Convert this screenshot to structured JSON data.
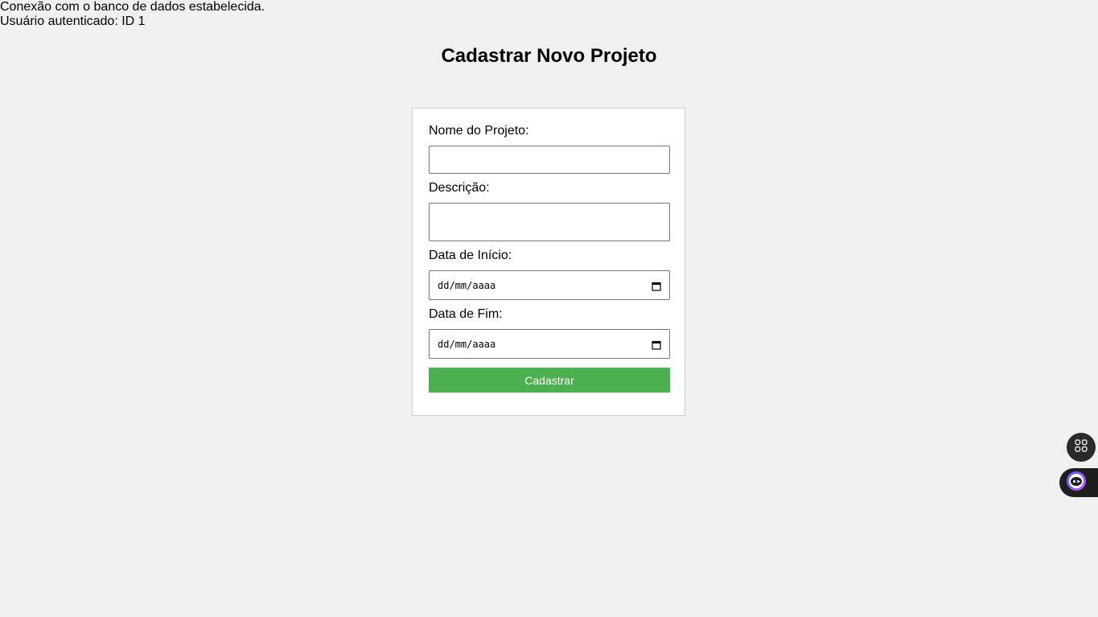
{
  "status": {
    "line1": "Conexão com o banco de dados estabelecida.",
    "line2": "Usuário autenticado: ID 1"
  },
  "page": {
    "title": "Cadastrar Novo Projeto"
  },
  "form": {
    "name_label": "Nome do Projeto:",
    "name_value": "",
    "description_label": "Descrição:",
    "description_value": "",
    "start_label": "Data de Início:",
    "start_placeholder": "dd/mm/aaaa",
    "end_label": "Data de Fim:",
    "end_placeholder": "dd/mm/aaaa",
    "submit_label": "Cadastrar"
  },
  "colors": {
    "background": "#f0f0f0",
    "submit": "#4caf50",
    "card": "#ffffff"
  },
  "icons": {
    "date_picker": "calendar-icon",
    "apps_widget": "grid-icon",
    "assistant_widget": "bot-icon"
  }
}
